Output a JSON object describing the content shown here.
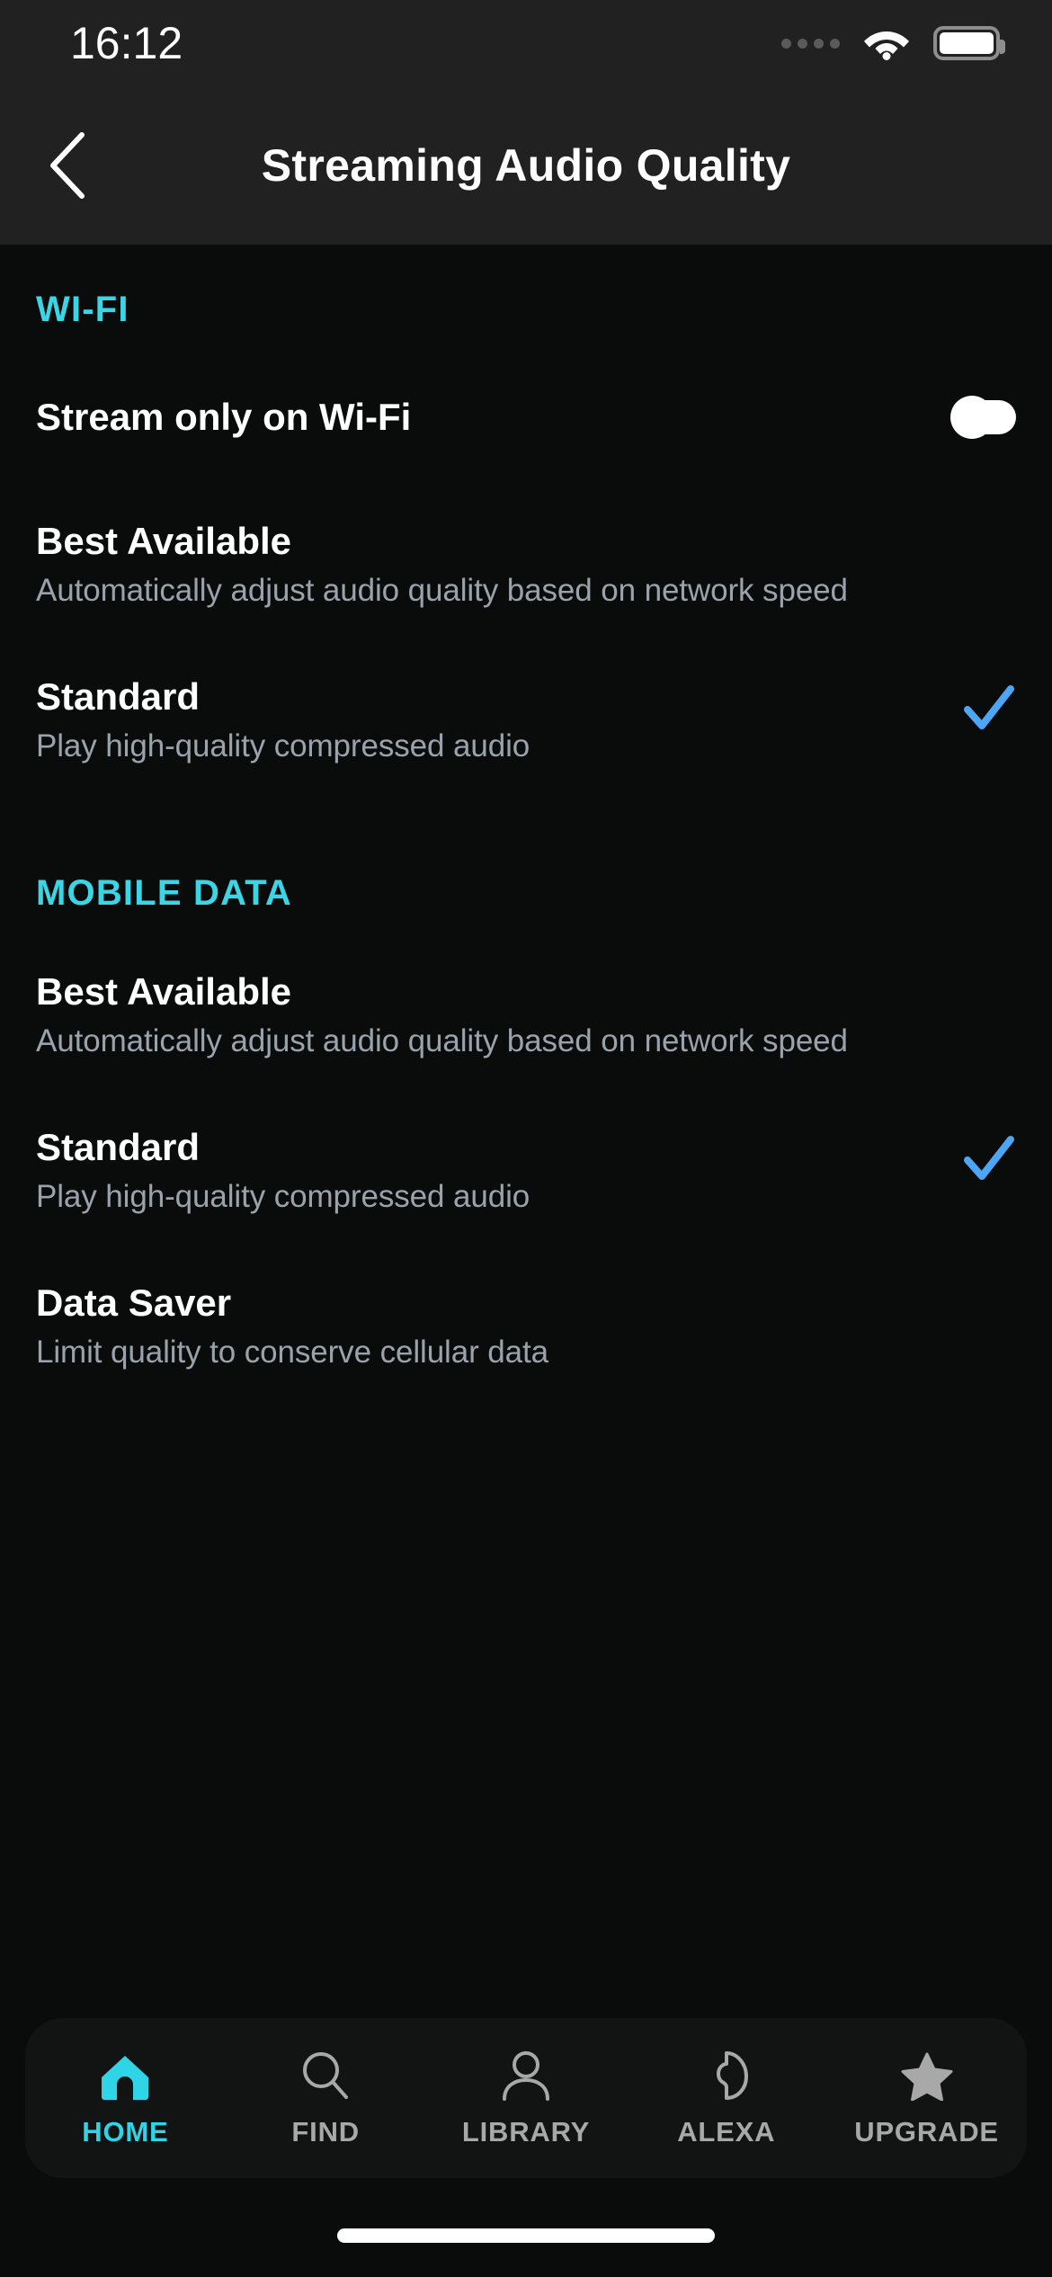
{
  "status_bar": {
    "time": "16:12",
    "signal_icon": "signal-dots-icon",
    "wifi_icon": "wifi-icon",
    "battery_icon": "battery-full-icon"
  },
  "header": {
    "back_icon": "chevron-left-icon",
    "title": "Streaming Audio Quality"
  },
  "colors": {
    "accent_cyan": "#3ad6e6",
    "check_blue": "#4da5f5",
    "background": "#0a0c0c",
    "bar_background": "#212121",
    "subtitle_grey": "#9aa3ab"
  },
  "sections": [
    {
      "header": "WI-FI",
      "toggle_row": {
        "title": "Stream only on Wi-Fi",
        "state": "off"
      },
      "options": [
        {
          "title": "Best Available",
          "subtitle": "Automatically adjust audio quality based on network speed",
          "selected": false
        },
        {
          "title": "Standard",
          "subtitle": "Play high-quality compressed audio",
          "selected": true
        }
      ]
    },
    {
      "header": "MOBILE DATA",
      "options": [
        {
          "title": "Best Available",
          "subtitle": "Automatically adjust audio quality based on network speed",
          "selected": false
        },
        {
          "title": "Standard",
          "subtitle": "Play high-quality compressed audio",
          "selected": true
        },
        {
          "title": "Data Saver",
          "subtitle": "Limit quality to conserve cellular data",
          "selected": false
        }
      ]
    }
  ],
  "tab_bar": {
    "items": [
      {
        "label": "HOME",
        "icon": "home-icon",
        "active": true
      },
      {
        "label": "FIND",
        "icon": "search-icon",
        "active": false
      },
      {
        "label": "LIBRARY",
        "icon": "person-icon",
        "active": false
      },
      {
        "label": "ALEXA",
        "icon": "alexa-icon",
        "active": false
      },
      {
        "label": "UPGRADE",
        "icon": "star-icon",
        "active": false
      }
    ]
  }
}
